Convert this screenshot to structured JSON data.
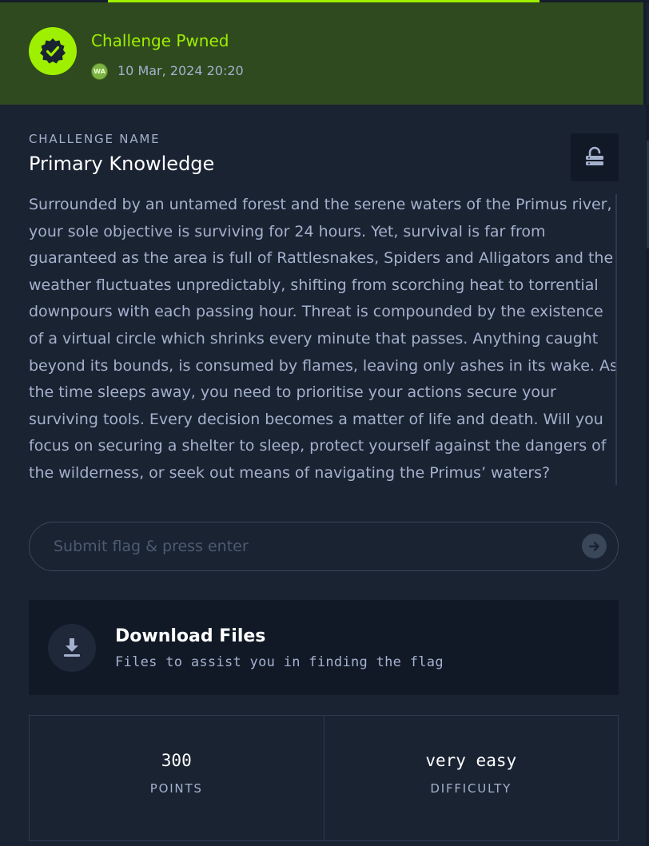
{
  "banner": {
    "title": "Challenge Pwned",
    "avatar_initials": "WA",
    "date": "10 Mar, 2024 20:20",
    "accent_color": "#9fef00",
    "badge_icon": "verified-check-icon"
  },
  "challenge": {
    "section_label": "CHALLENGE NAME",
    "name": "Primary Knowledge",
    "lock_icon": "unlock-icon",
    "description": "Surrounded by an untamed forest and the serene waters of the Primus river, your sole objective is surviving for 24 hours. Yet, survival is far from guaranteed as the area is full of Rattlesnakes, Spiders and Alligators and the weather fluctuates unpredictably, shifting from scorching heat to torrential downpours with each passing hour. Threat is compounded by the existence of a virtual circle which shrinks every minute that passes. Anything caught beyond its bounds, is consumed by flames, leaving only ashes in its wake. As the time sleeps away, you need to prioritise your actions secure your surviving tools. Every decision becomes a matter of life and death. Will you focus on securing a shelter to sleep, protect yourself against the dangers of the wilderness, or seek out means of navigating the Primus’ waters?"
  },
  "flag": {
    "placeholder": "Submit flag & press enter",
    "value": "",
    "submit_icon": "arrow-right-icon"
  },
  "download": {
    "title": "Download Files",
    "subtitle": "Files to assist you in finding the flag",
    "icon": "download-icon"
  },
  "stats": [
    {
      "value": "300",
      "label": "POINTS"
    },
    {
      "value": "very easy",
      "label": "DIFFICULTY"
    }
  ]
}
